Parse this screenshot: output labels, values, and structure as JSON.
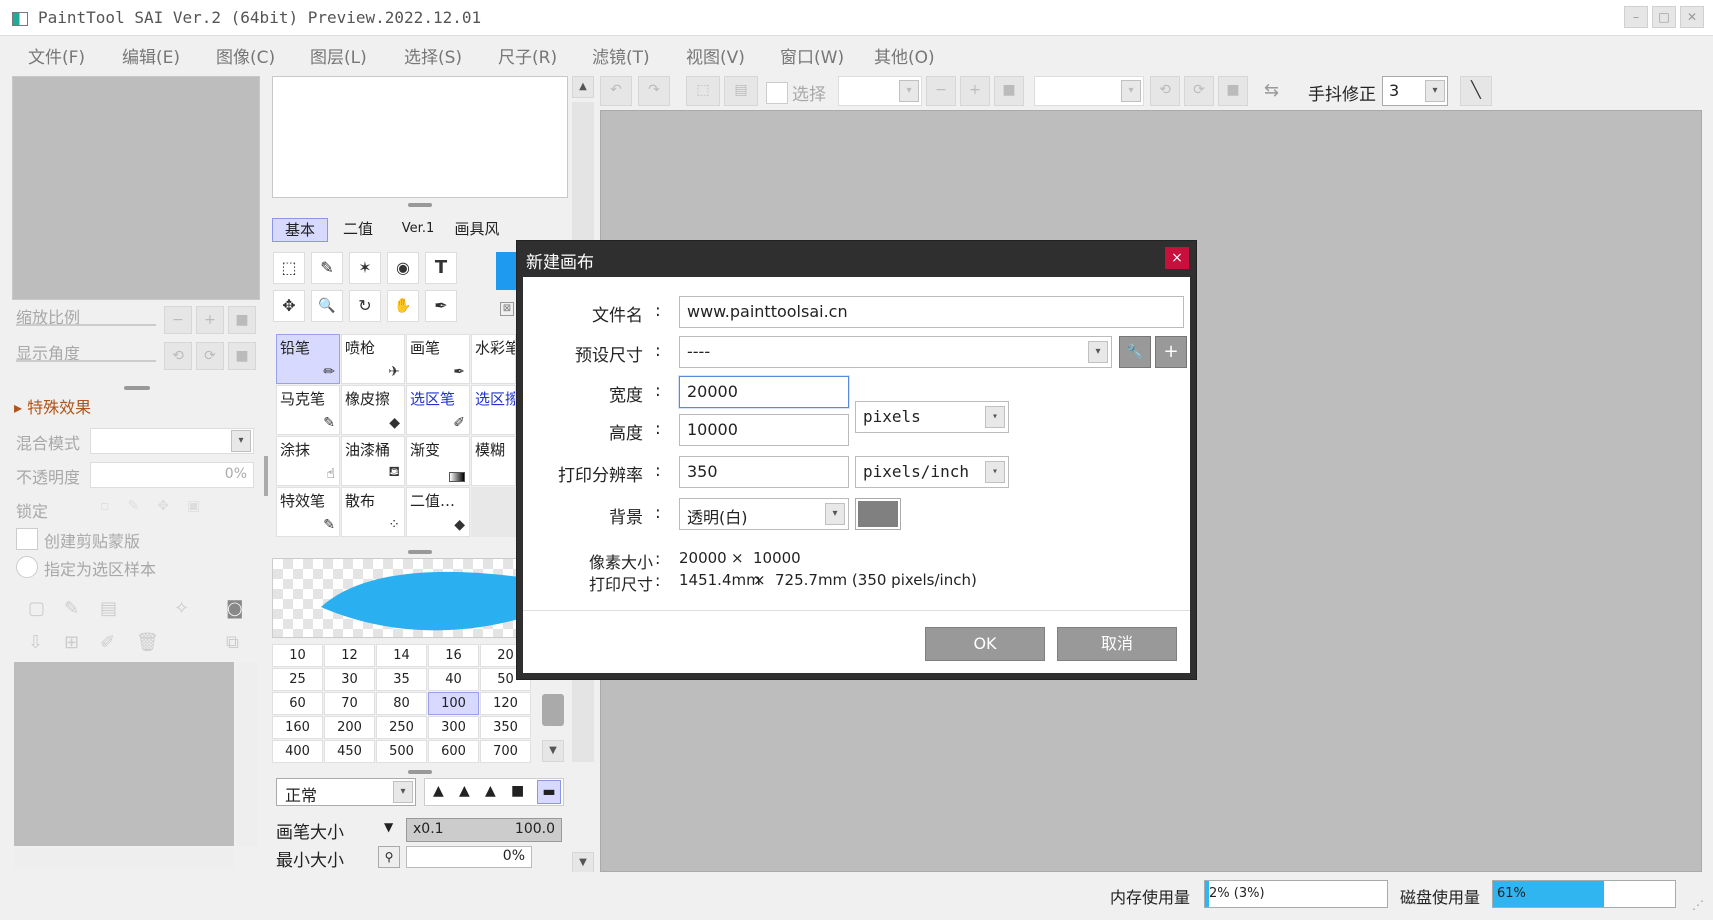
{
  "window": {
    "title": "PaintTool SAI Ver.2 (64bit) Preview.2022.12.01",
    "min": "–",
    "max": "□",
    "close": "✕"
  },
  "menu": [
    "文件(F)",
    "编辑(E)",
    "图像(C)",
    "图层(L)",
    "选择(S)",
    "尺子(R)",
    "滤镜(T)",
    "视图(V)",
    "窗口(W)",
    "其他(O)"
  ],
  "left_panel": {
    "zoom_label": "缩放比例",
    "angle_label": "显示角度",
    "effects_label": "特殊效果",
    "blend_label": "混合模式",
    "opacity_label": "不透明度",
    "opacity_value": "0%",
    "lock_label": "锁定",
    "clip_label": "创建剪贴蒙版",
    "sample_label": "指定为选区样本"
  },
  "brush_panel": {
    "tabs": [
      "基本",
      "二值",
      "Ver.1",
      "画具风"
    ],
    "tools_row1": [
      "⬚",
      "✎",
      "✶",
      "◉",
      "T"
    ],
    "tools_row2": [
      "✥",
      "🔍",
      "↻",
      "✋",
      "✒"
    ],
    "brushes": [
      [
        "铅笔",
        "喷枪",
        "画笔",
        "水彩笔"
      ],
      [
        "马克笔",
        "橡皮擦",
        "选区笔",
        "选区擦"
      ],
      [
        "涂抹",
        "油漆桶",
        "渐变",
        "模糊"
      ],
      [
        "特效笔",
        "散布",
        "二值…",
        ""
      ]
    ],
    "sizes": [
      [
        "10",
        "12",
        "14",
        "16",
        "20"
      ],
      [
        "25",
        "30",
        "35",
        "40",
        "50"
      ],
      [
        "60",
        "70",
        "80",
        "100",
        "120"
      ],
      [
        "160",
        "200",
        "250",
        "300",
        "350"
      ],
      [
        "400",
        "450",
        "500",
        "600",
        "700"
      ]
    ],
    "blend_mode": "正常",
    "brush_size_label": "画笔大小",
    "brush_size_mult": "x0.1",
    "brush_size_value": "100.0",
    "min_size_label": "最小大小",
    "min_size_value": "0%"
  },
  "toolbar": {
    "select_label": "选择",
    "stabilizer_label": "手抖修正",
    "stabilizer_value": "3",
    "accent": "#1e8fff"
  },
  "dialog": {
    "title": "新建画布",
    "close": "×",
    "filename_label": "文件名",
    "filename_value": "www.painttoolsai.cn",
    "preset_label": "预设尺寸",
    "preset_value": "----",
    "width_label": "宽度",
    "width_value": "20000",
    "height_label": "高度",
    "height_value": "10000",
    "unit_value": "pixels",
    "dpi_label": "打印分辨率",
    "dpi_value": "350",
    "dpi_unit": "pixels/inch",
    "bg_label": "背景",
    "bg_value": "透明(白)",
    "bg_color": "#808080",
    "pixel_size_label": "像素大小",
    "pixel_size_w": "20000",
    "pixel_size_x": "×",
    "pixel_size_h": "10000",
    "print_size_label": "打印尺寸",
    "print_size_w": "1451.4mm",
    "print_size_h": "725.7mm (350 pixels/inch)",
    "ok": "OK",
    "cancel": "取消",
    "colon": ":"
  },
  "status": {
    "memory_label": "内存使用量",
    "memory_value": "2% (3%)",
    "memory_pct": 0.02,
    "disk_label": "磁盘使用量",
    "disk_value": "61%",
    "disk_pct": 0.61
  }
}
